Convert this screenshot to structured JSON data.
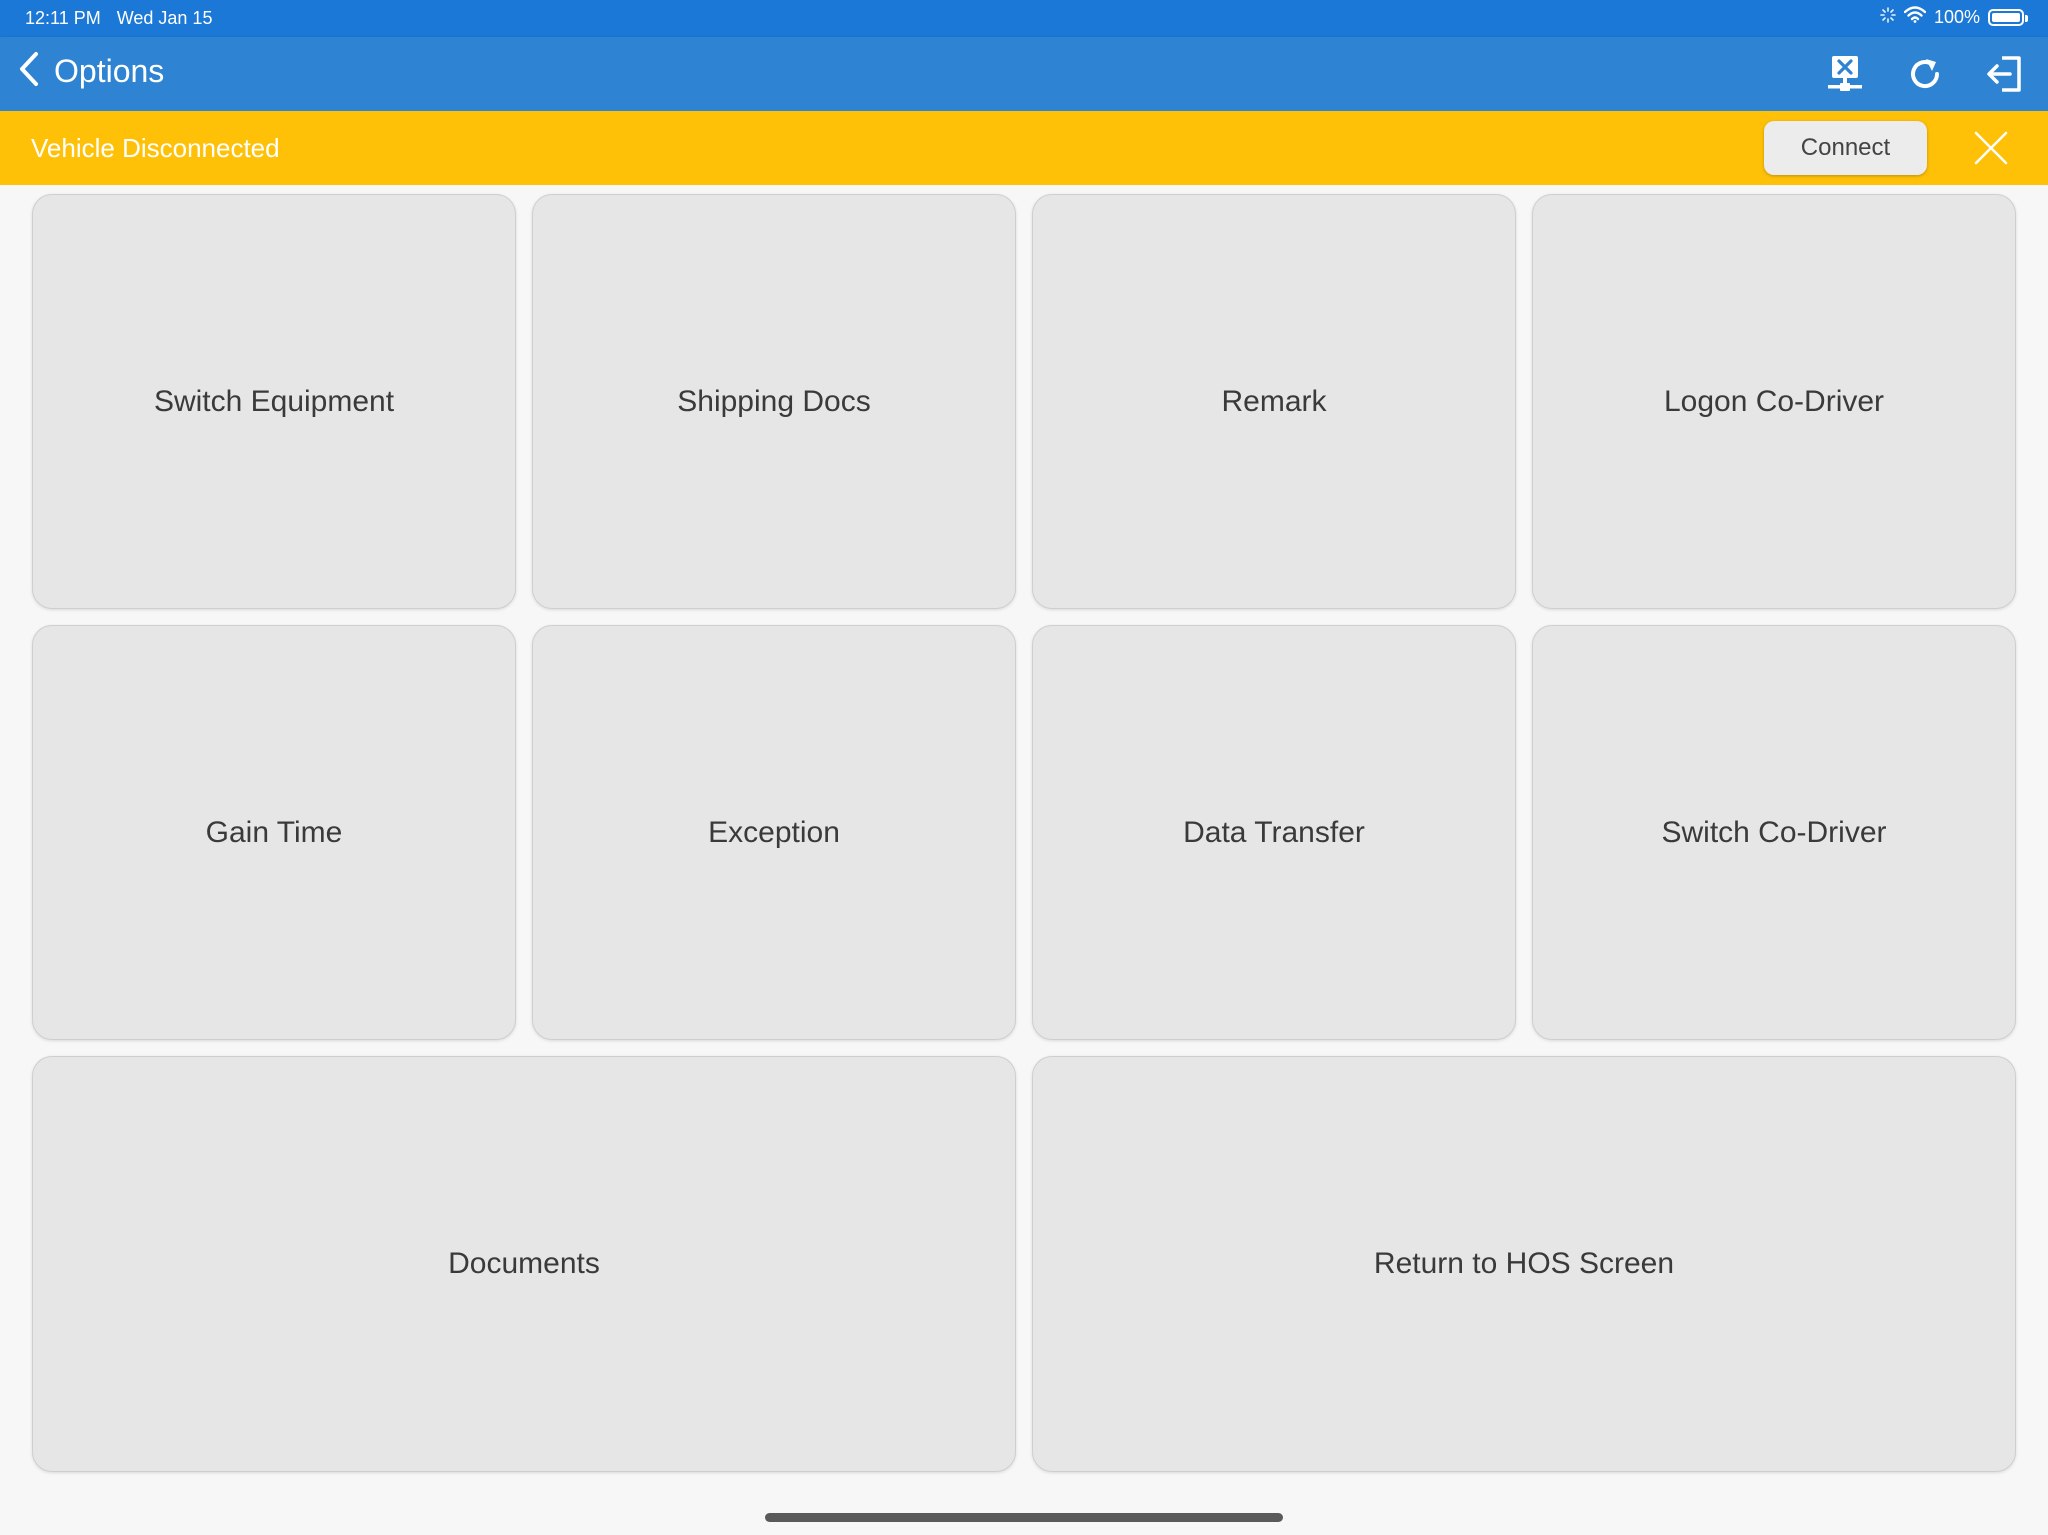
{
  "status_bar": {
    "time": "12:11 PM",
    "date": "Wed Jan 15",
    "battery": "100%",
    "icons": [
      "activity-spinner-icon",
      "wifi-icon",
      "battery-icon"
    ]
  },
  "nav": {
    "title": "Options",
    "actions": [
      "network-disconnected-icon",
      "refresh-icon",
      "logout-icon"
    ]
  },
  "banner": {
    "message": "Vehicle Disconnected",
    "connect_label": "Connect",
    "color": "#ffc107"
  },
  "tiles": [
    {
      "label": "Switch Equipment"
    },
    {
      "label": "Shipping Docs"
    },
    {
      "label": "Remark"
    },
    {
      "label": "Logon Co-Driver"
    },
    {
      "label": "Gain Time"
    },
    {
      "label": "Exception"
    },
    {
      "label": "Data Transfer"
    },
    {
      "label": "Switch Co-Driver"
    },
    {
      "label": "Documents"
    },
    {
      "label": "Return to HOS Screen"
    }
  ],
  "colors": {
    "status_bar": "#1b78d6",
    "nav_bar": "#2e83d2",
    "tile": "#e6e6e6"
  }
}
